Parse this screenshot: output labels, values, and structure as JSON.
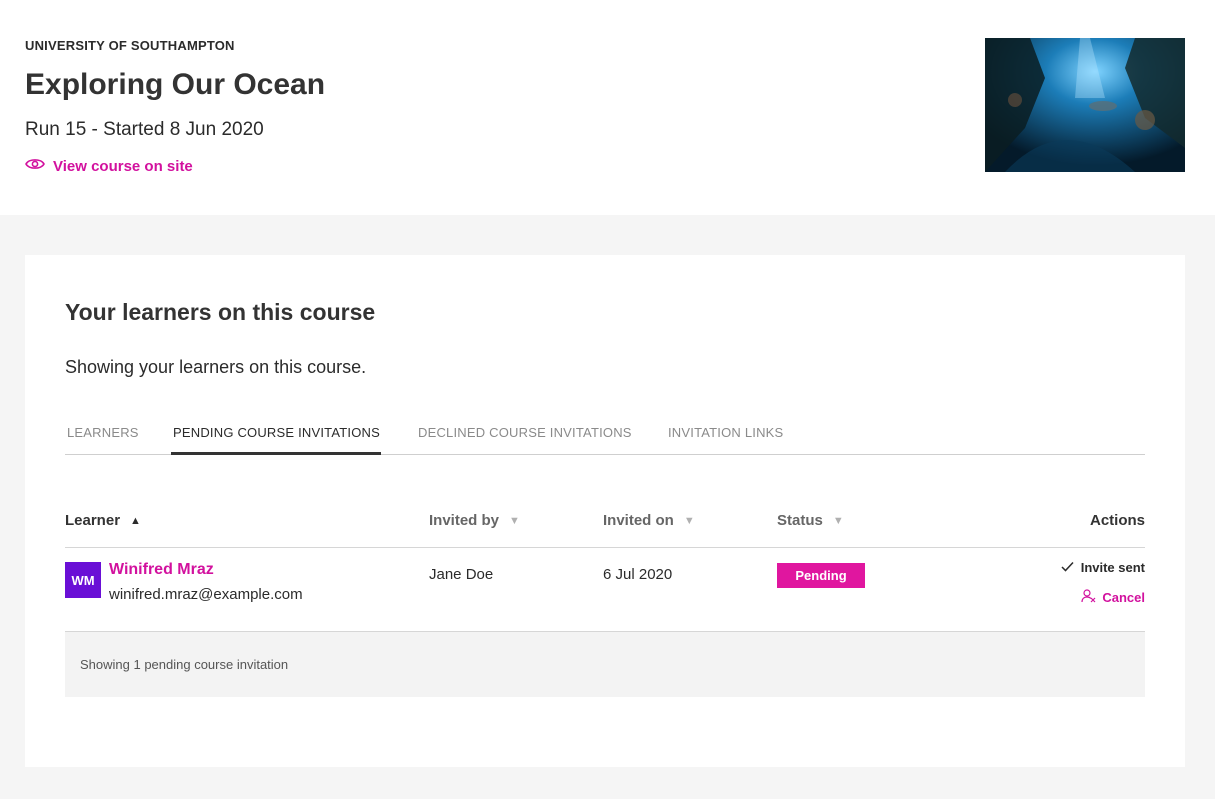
{
  "header": {
    "university": "UNIVERSITY OF SOUTHAMPTON",
    "course_title": "Exploring Our Ocean",
    "run_info": "Run 15 - Started 8 Jun 2020",
    "view_link": "View course on site"
  },
  "panel": {
    "title": "Your learners on this course",
    "subtitle": "Showing your learners on this course.",
    "tabs": [
      {
        "label": "LEARNERS",
        "active": false
      },
      {
        "label": "PENDING COURSE INVITATIONS",
        "active": true
      },
      {
        "label": "DECLINED COURSE INVITATIONS",
        "active": false
      },
      {
        "label": "INVITATION LINKS",
        "active": false
      }
    ]
  },
  "table": {
    "columns": {
      "learner": "Learner",
      "invited_by": "Invited by",
      "invited_on": "Invited on",
      "status": "Status",
      "actions": "Actions"
    },
    "rows": [
      {
        "initials": "WM",
        "name": "Winifred Mraz",
        "email": "winifred.mraz@example.com",
        "invited_by": "Jane Doe",
        "invited_on": "6 Jul 2020",
        "status": "Pending",
        "action_sent": "Invite sent",
        "action_cancel": "Cancel"
      }
    ],
    "footer": "Showing 1 pending course invitation"
  },
  "colors": {
    "accent": "#d2119e",
    "badge": "#e0169f",
    "avatar": "#6a0fd6"
  }
}
